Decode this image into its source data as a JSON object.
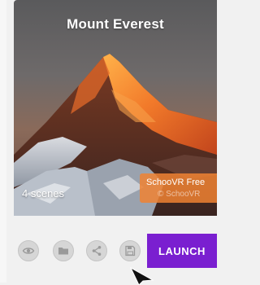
{
  "card": {
    "title": "Mount Everest",
    "scene_count_label": "4 scenes",
    "badge_label": "SchooVR Free",
    "badge_sub": "© SchooVR"
  },
  "toolbar": {
    "launch_label": "LAUNCH",
    "icons": [
      "eye-icon",
      "folder-icon",
      "share-icon",
      "save-icon"
    ]
  },
  "colors": {
    "launch_bg": "#7a1fd0",
    "badge_bg": "#f08232",
    "toolbar_bg": "#f1f1f1"
  }
}
